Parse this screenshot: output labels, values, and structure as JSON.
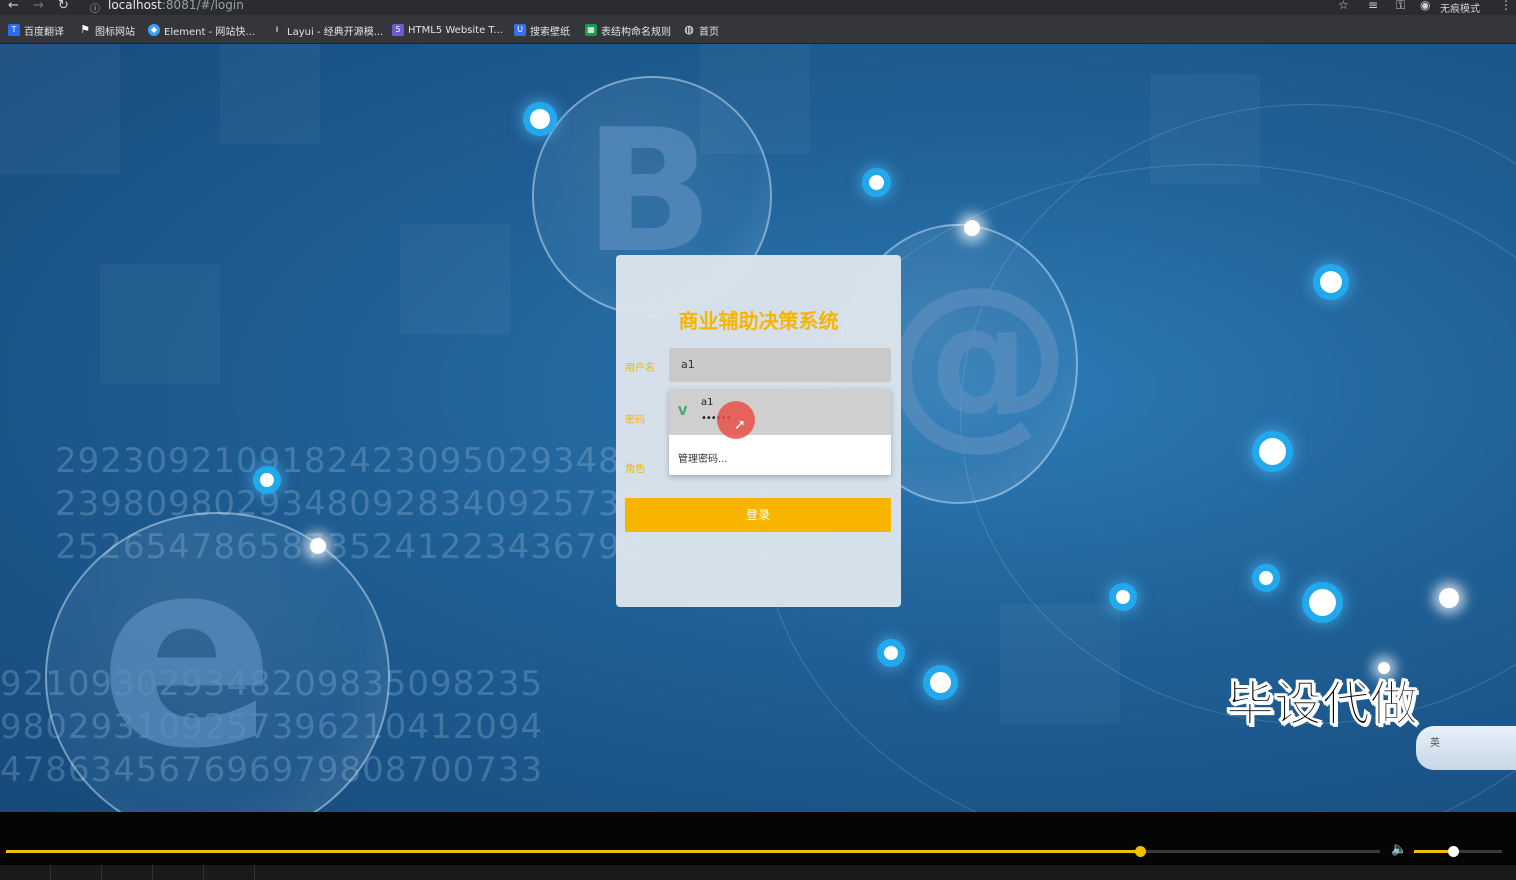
{
  "browser": {
    "url_host": "localhost",
    "url_rest": ":8081/#/login",
    "incognito_label": "无痕模式"
  },
  "bookmarks": [
    {
      "label": "百度翻译",
      "icon": "translate-icon",
      "color": "#2b6de8"
    },
    {
      "label": "图标网站",
      "icon": "flag-icon",
      "color": "#444"
    },
    {
      "label": "Element - 网站快...",
      "icon": "element-icon",
      "color": "#409eff"
    },
    {
      "label": "Layui - 经典开源模...",
      "icon": "layui-icon",
      "color": "#444"
    },
    {
      "label": "HTML5 Website T...",
      "icon": "html5-icon",
      "color": "#6b5bd6"
    },
    {
      "label": "搜索壁纸",
      "icon": "wallpaper-icon",
      "color": "#3a6ee8"
    },
    {
      "label": "表结构命名规则",
      "icon": "table-icon",
      "color": "#1a9a55"
    },
    {
      "label": "首页",
      "icon": "globe-icon",
      "color": "#555"
    }
  ],
  "background_numbers": [
    "2923092109182423095029348",
    "23980980293480928340925739",
    "25265478658735241223436790"
  ],
  "background_numbers_lower": [
    "921093029348209835098235",
    "980293109257396210412094",
    "478634567696979808700733"
  ],
  "login": {
    "title": "商业辅助决策系统",
    "username_label": "用户名",
    "username_value": "a1",
    "password_label": "密码",
    "role_label": "角色",
    "autofill_user": "a1",
    "autofill_password": "••••••",
    "autofill_manage": "管理密码...",
    "submit_label": "登录"
  },
  "watermark": "毕设代做",
  "ime_label": "英",
  "player": {
    "progress_percent": 82.5,
    "volume_percent": 44
  },
  "colors": {
    "accent": "#f7b500",
    "background": "#1f5f95"
  }
}
